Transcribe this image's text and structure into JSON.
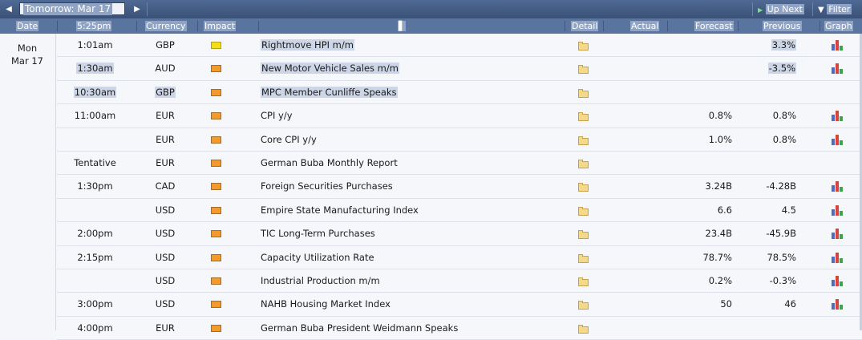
{
  "toolbar": {
    "period": "Tomorrow: Mar 17",
    "up_next": "Up Next",
    "filter": "Filter"
  },
  "columns": {
    "date": "Date",
    "time": "5:25pm",
    "currency": "Currency",
    "impact": "Impact",
    "event_marker": "▌",
    "detail": "Detail",
    "actual": "Actual",
    "forecast": "Forecast",
    "previous": "Previous",
    "graph": "Graph"
  },
  "day": {
    "weekday": "Mon",
    "date": "Mar 17"
  },
  "rows": [
    {
      "time": "1:01am",
      "currency": "GBP",
      "impact": "low",
      "event": "Rightmove HPI m/m",
      "forecast": "",
      "previous": "3.3%",
      "graph": true
    },
    {
      "time": "1:30am",
      "currency": "AUD",
      "impact": "high",
      "event": "New Motor Vehicle Sales m/m",
      "forecast": "",
      "previous": "-3.5%",
      "graph": true
    },
    {
      "time": "10:30am",
      "currency": "GBP",
      "impact": "high",
      "event": "MPC Member Cunliffe Speaks",
      "forecast": "",
      "previous": "",
      "graph": false
    },
    {
      "time": "11:00am",
      "currency": "EUR",
      "impact": "high",
      "event": "CPI y/y",
      "forecast": "0.8%",
      "previous": "0.8%",
      "graph": true
    },
    {
      "time": "",
      "currency": "EUR",
      "impact": "high",
      "event": "Core CPI y/y",
      "forecast": "1.0%",
      "previous": "0.8%",
      "graph": true
    },
    {
      "time": "Tentative",
      "currency": "EUR",
      "impact": "high",
      "event": "German Buba Monthly Report",
      "forecast": "",
      "previous": "",
      "graph": false
    },
    {
      "time": "1:30pm",
      "currency": "CAD",
      "impact": "high",
      "event": "Foreign Securities Purchases",
      "forecast": "3.24B",
      "previous": "-4.28B",
      "graph": true
    },
    {
      "time": "",
      "currency": "USD",
      "impact": "high",
      "event": "Empire State Manufacturing Index",
      "forecast": "6.6",
      "previous": "4.5",
      "graph": true
    },
    {
      "time": "2:00pm",
      "currency": "USD",
      "impact": "high",
      "event": "TIC Long-Term Purchases",
      "forecast": "23.4B",
      "previous": "-45.9B",
      "graph": true
    },
    {
      "time": "2:15pm",
      "currency": "USD",
      "impact": "high",
      "event": "Capacity Utilization Rate",
      "forecast": "78.7%",
      "previous": "78.5%",
      "graph": true
    },
    {
      "time": "",
      "currency": "USD",
      "impact": "high",
      "event": "Industrial Production m/m",
      "forecast": "0.2%",
      "previous": "-0.3%",
      "graph": true
    },
    {
      "time": "3:00pm",
      "currency": "USD",
      "impact": "high",
      "event": "NAHB Housing Market Index",
      "forecast": "50",
      "previous": "46",
      "graph": true
    },
    {
      "time": "4:00pm",
      "currency": "EUR",
      "impact": "high",
      "event": "German Buba President Weidmann Speaks",
      "forecast": "",
      "previous": "",
      "graph": false
    }
  ],
  "colors": {
    "header_bg": "#5a74a0",
    "topbar_bg": "#3a5177",
    "impact_high": "#f39a2c",
    "impact_low": "#f4df17"
  }
}
